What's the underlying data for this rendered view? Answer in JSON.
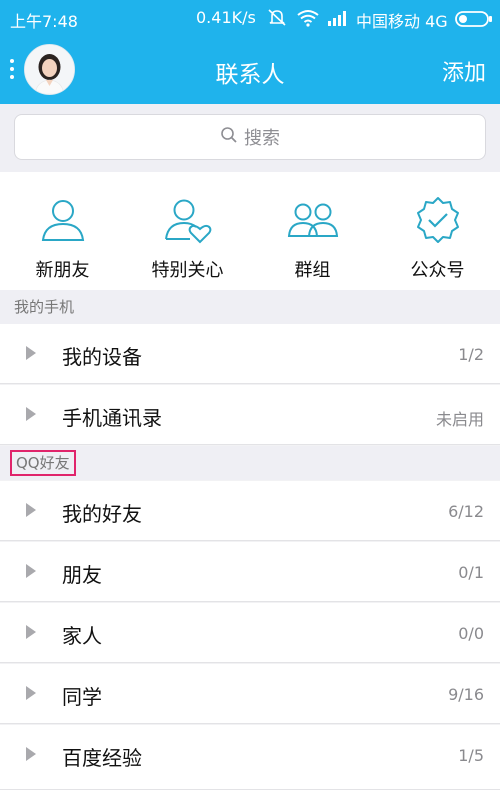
{
  "status_bar": {
    "time": "上午7:48",
    "speed": "0.41K/s",
    "carrier": "中国移动 4G",
    "icons": [
      "mute-icon",
      "wifi-icon",
      "signal-icon",
      "battery-icon"
    ]
  },
  "nav": {
    "title": "联系人",
    "add_label": "添加"
  },
  "search": {
    "placeholder": "搜索"
  },
  "quick_actions": [
    {
      "label": "新朋友",
      "icon": "person-icon"
    },
    {
      "label": "特别关心",
      "icon": "person-heart-icon"
    },
    {
      "label": "群组",
      "icon": "group-icon"
    },
    {
      "label": "公众号",
      "icon": "badge-check-icon"
    }
  ],
  "sections": {
    "phone": {
      "header": "我的手机",
      "rows": [
        {
          "label": "我的设备",
          "count": "1/2"
        },
        {
          "label": "手机通讯录",
          "count": "未启用"
        }
      ]
    },
    "qq": {
      "header": "QQ好友",
      "rows": [
        {
          "label": "我的好友",
          "count": "6/12"
        },
        {
          "label": "朋友",
          "count": "0/1"
        },
        {
          "label": "家人",
          "count": "0/0"
        },
        {
          "label": "同学",
          "count": "9/16"
        },
        {
          "label": "百度经验",
          "count": "1/5"
        }
      ]
    }
  },
  "colors": {
    "accent": "#1fb3ec",
    "highlight_border": "#e0246b",
    "icon_teal": "#2aa7c6"
  }
}
